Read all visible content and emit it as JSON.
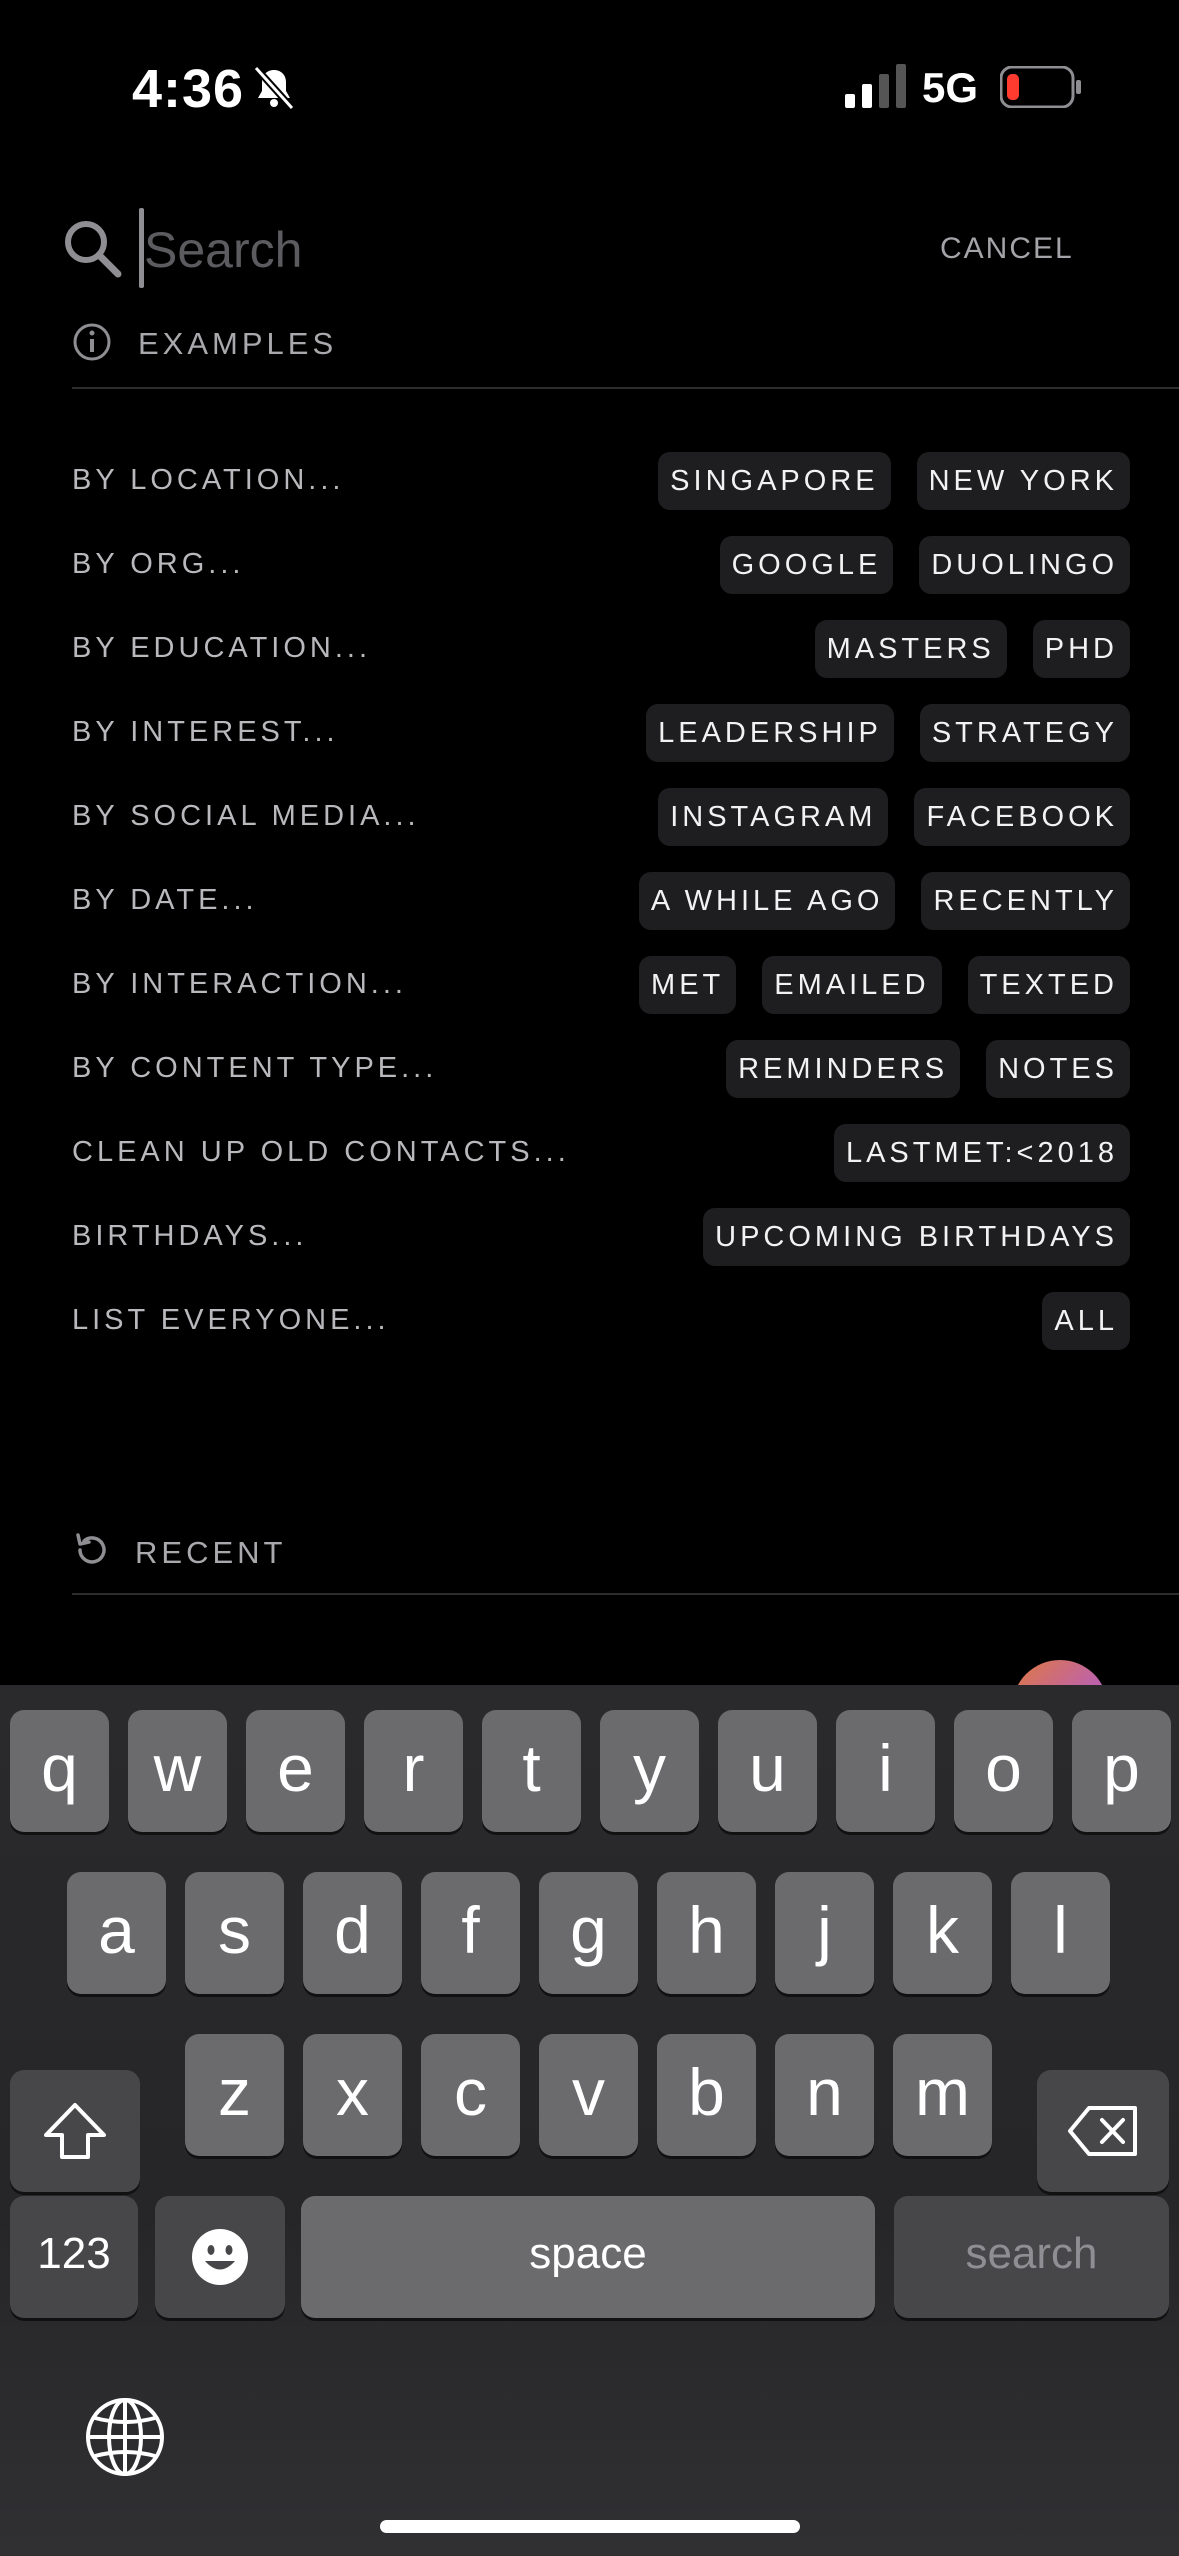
{
  "status_bar": {
    "time": "4:36",
    "network": "5G"
  },
  "search": {
    "placeholder": "Search",
    "cancel_label": "CANCEL"
  },
  "examples": {
    "header": "EXAMPLES",
    "rows": [
      {
        "label": "BY LOCATION...",
        "chips": [
          "SINGAPORE",
          "NEW YORK"
        ]
      },
      {
        "label": "BY ORG...",
        "chips": [
          "GOOGLE",
          "DUOLINGO"
        ]
      },
      {
        "label": "BY EDUCATION...",
        "chips": [
          "MASTERS",
          "PHD"
        ]
      },
      {
        "label": "BY INTEREST...",
        "chips": [
          "LEADERSHIP",
          "STRATEGY"
        ]
      },
      {
        "label": "BY SOCIAL MEDIA...",
        "chips": [
          "INSTAGRAM",
          "FACEBOOK"
        ]
      },
      {
        "label": "BY DATE...",
        "chips": [
          "A WHILE AGO",
          "RECENTLY"
        ]
      },
      {
        "label": "BY INTERACTION...",
        "chips": [
          "MET",
          "EMAILED",
          "TEXTED"
        ]
      },
      {
        "label": "BY CONTENT TYPE...",
        "chips": [
          "REMINDERS",
          "NOTES"
        ]
      },
      {
        "label": "CLEAN UP OLD CONTACTS...",
        "chips": [
          "LASTMET:<2018"
        ]
      },
      {
        "label": "BIRTHDAYS...",
        "chips": [
          "UPCOMING BIRTHDAYS"
        ]
      },
      {
        "label": "LIST EVERYONE...",
        "chips": [
          "ALL"
        ]
      }
    ]
  },
  "recent": {
    "header": "RECENT"
  },
  "keyboard": {
    "row1": [
      "q",
      "w",
      "e",
      "r",
      "t",
      "y",
      "u",
      "i",
      "o",
      "p"
    ],
    "row2": [
      "a",
      "s",
      "d",
      "f",
      "g",
      "h",
      "j",
      "k",
      "l"
    ],
    "row3": [
      "z",
      "x",
      "c",
      "v",
      "b",
      "n",
      "m"
    ],
    "numbers_label": "123",
    "space_label": "space",
    "search_label": "search"
  }
}
